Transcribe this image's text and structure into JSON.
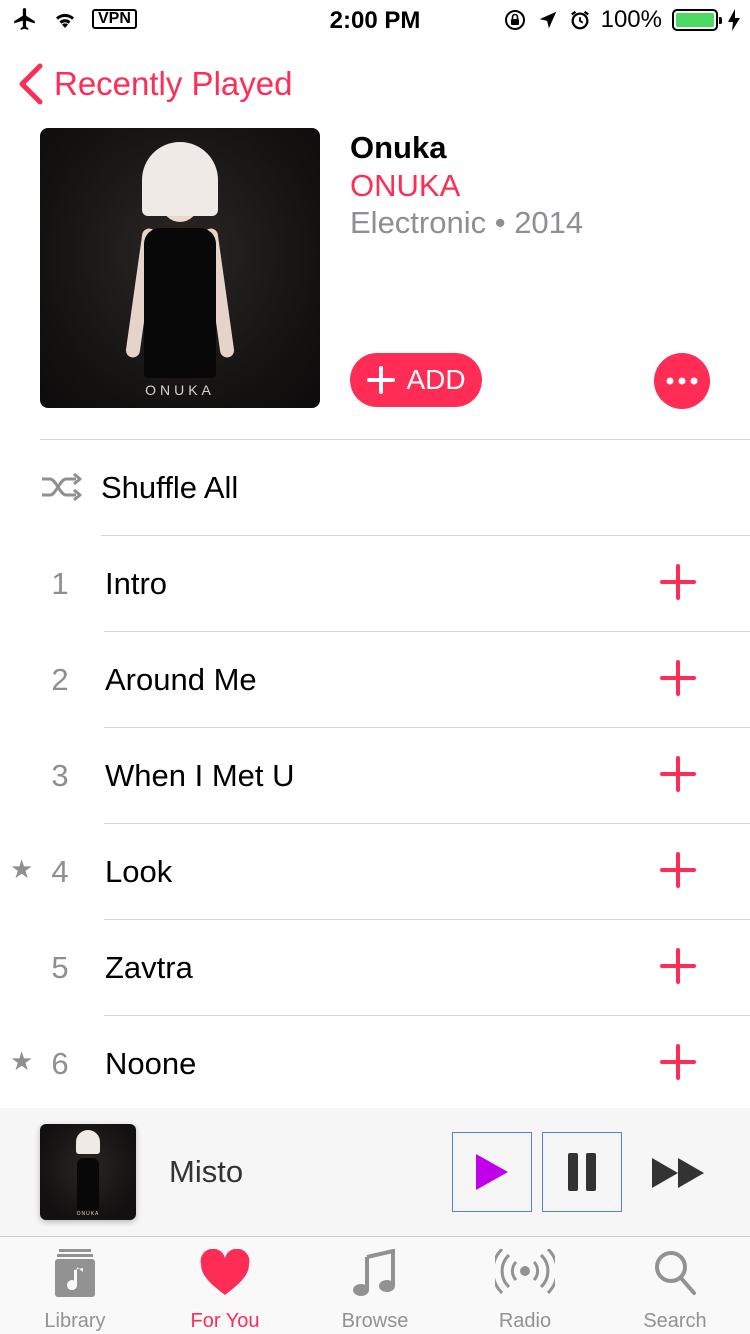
{
  "status_bar": {
    "vpn": "VPN",
    "time": "2:00 PM",
    "battery": "100%",
    "battery_level": 1.0
  },
  "nav": {
    "back_label": "Recently Played"
  },
  "album": {
    "title": "Onuka",
    "artist": "ONUKA",
    "genre_year": "Electronic • 2014",
    "art_text": "ONUKA",
    "add_label": "ADD"
  },
  "list": {
    "shuffle_label": "Shuffle All",
    "tracks": [
      {
        "num": "1",
        "name": "Intro",
        "star": ""
      },
      {
        "num": "2",
        "name": "Around Me",
        "star": ""
      },
      {
        "num": "3",
        "name": "When I Met U",
        "star": ""
      },
      {
        "num": "4",
        "name": "Look",
        "star": "★"
      },
      {
        "num": "5",
        "name": "Zavtra",
        "star": ""
      },
      {
        "num": "6",
        "name": "Noone",
        "star": "★"
      }
    ]
  },
  "mini_player": {
    "song": "Misto",
    "thumb_text": "ONUKA"
  },
  "tabs": [
    {
      "label": "Library",
      "icon": "library-icon",
      "active": false
    },
    {
      "label": "For You",
      "icon": "heart-icon",
      "active": true
    },
    {
      "label": "Browse",
      "icon": "music-note-icon",
      "active": false
    },
    {
      "label": "Radio",
      "icon": "radio-icon",
      "active": false
    },
    {
      "label": "Search",
      "icon": "search-icon",
      "active": false
    }
  ],
  "colors": {
    "accent": "#ff2d55",
    "secondary_text": "#8e8e93",
    "battery_green": "#4cd964",
    "play_purple": "#c000e8"
  }
}
